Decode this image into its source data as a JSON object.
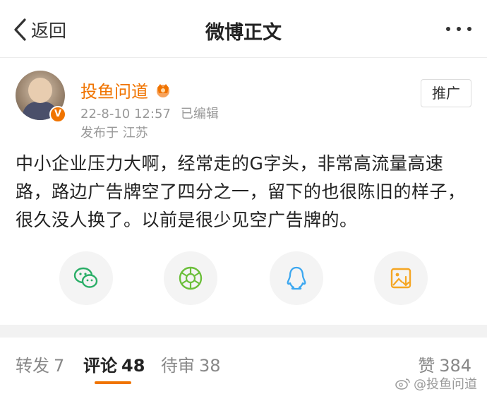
{
  "nav": {
    "back_label": "返回",
    "title": "微博正文"
  },
  "author": {
    "name": "投鱼问道",
    "verified_badge": "V",
    "date": "22-8-10 12:57",
    "edited": "已编辑",
    "location": "发布于 江苏",
    "promote_label": "推广",
    "name_color": "#f07400"
  },
  "post": {
    "text": "中小企业压力大啊，经常走的G字头，非常高流量高速路，路边广告牌空了四分之一，留下的也很陈旧的样子，很久没人换了。以前是很少见空广告牌的。"
  },
  "share_icons": [
    "wechat-icon",
    "moments-icon",
    "qq-icon",
    "save-image-icon"
  ],
  "tabs": {
    "repost": {
      "label": "转发",
      "count": "7"
    },
    "comments": {
      "label": "评论",
      "count": "48"
    },
    "pending": {
      "label": "待审",
      "count": "38"
    },
    "likes": {
      "label": "赞",
      "count": "384"
    }
  },
  "watermark": "@投鱼问道",
  "colors": {
    "accent": "#f07400",
    "wechat": "#2aae67",
    "moments": "#6bbf3a",
    "qq": "#3ba7f0",
    "save": "#f5a623"
  }
}
